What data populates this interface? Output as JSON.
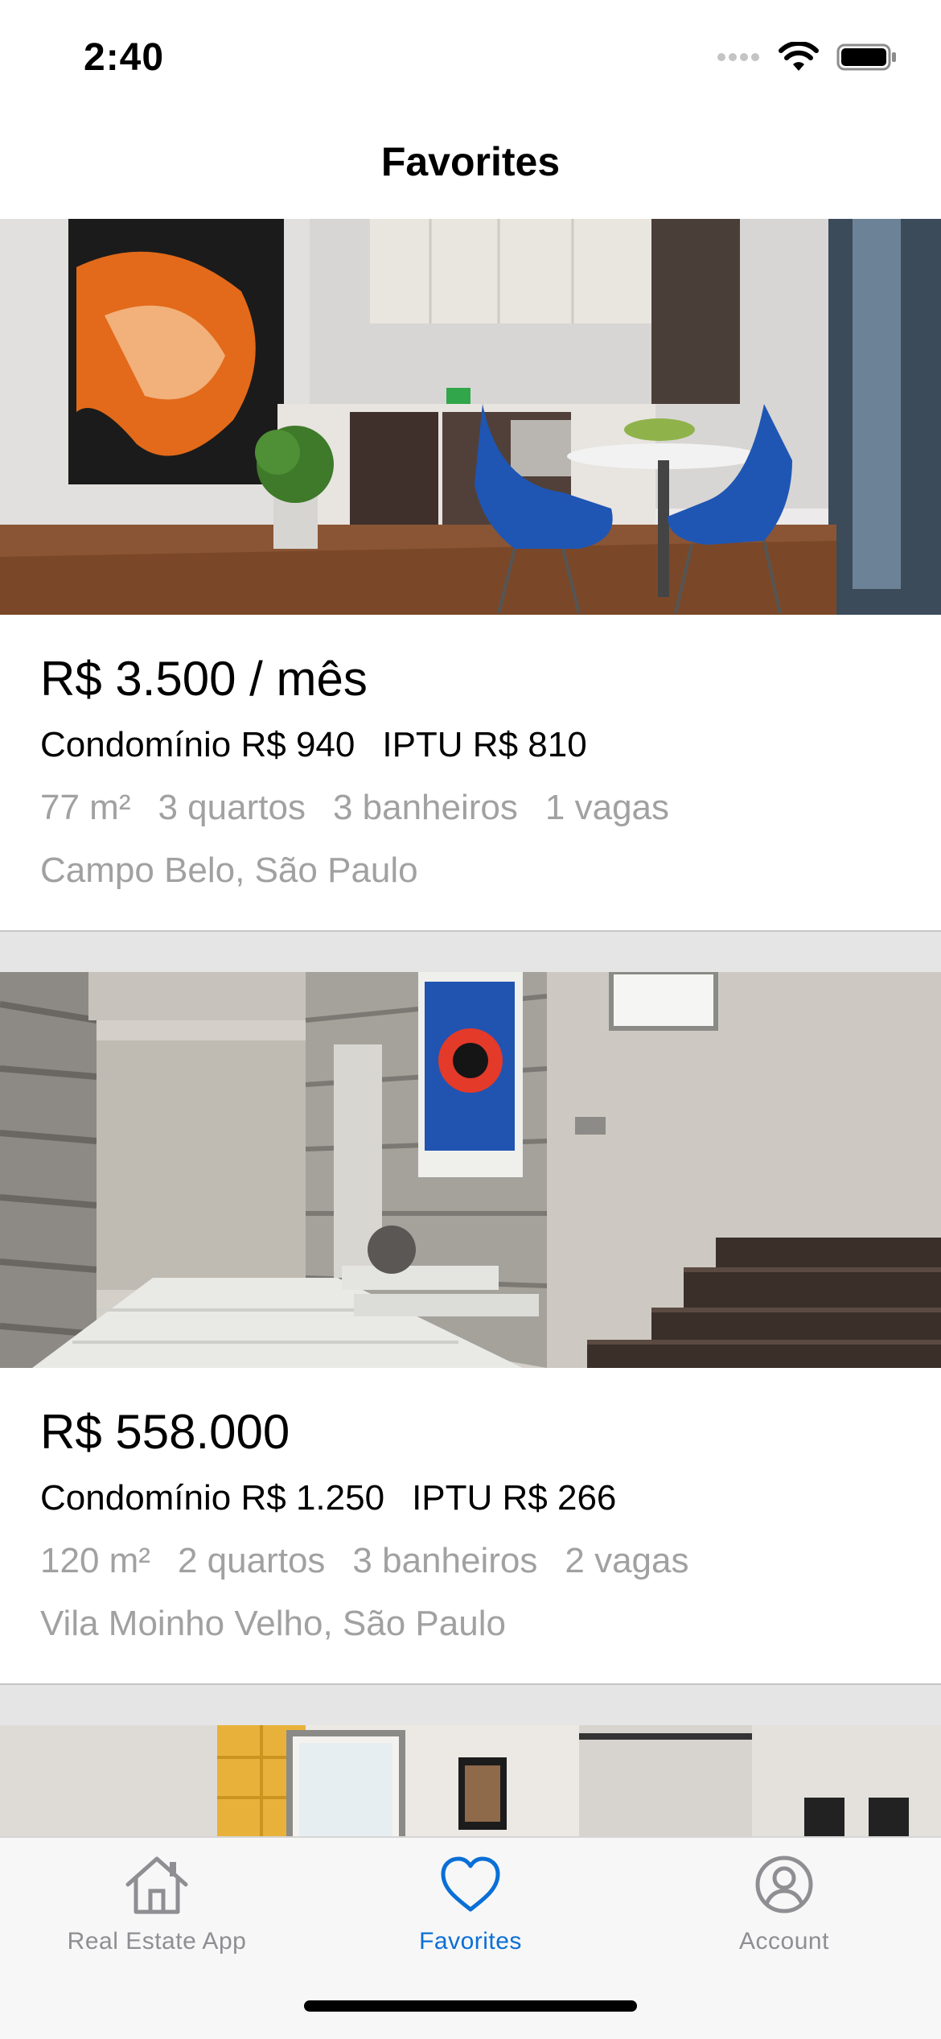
{
  "status": {
    "time": "2:40"
  },
  "nav": {
    "title": "Favorites"
  },
  "listings": [
    {
      "price": "R$ 3.500 / mês",
      "condominio": "Condomínio R$ 940",
      "iptu": "IPTU R$ 810",
      "area": "77 m²",
      "bedrooms": "3 quartos",
      "bathrooms": "3 banheiros",
      "parking": "1 vagas",
      "location": "Campo Belo, São Paulo",
      "image_icon": "kitchen-photo"
    },
    {
      "price": "R$ 558.000",
      "condominio": "Condomínio R$ 1.250",
      "iptu": "IPTU R$ 266",
      "area": "120 m²",
      "bedrooms": "2 quartos",
      "bathrooms": "3 banheiros",
      "parking": "2 vagas",
      "location": "Vila Moinho Velho, São Paulo",
      "image_icon": "hallway-photo"
    }
  ],
  "tabs": [
    {
      "label": "Real Estate App",
      "icon": "house-icon",
      "active": false
    },
    {
      "label": "Favorites",
      "icon": "heart-icon",
      "active": true
    },
    {
      "label": "Account",
      "icon": "person-circle-icon",
      "active": false
    }
  ],
  "colors": {
    "accent": "#0a6fd6",
    "inactive": "#8e8e93",
    "secondary_text": "#a1a1a1",
    "separator": "#e5e5e5"
  }
}
